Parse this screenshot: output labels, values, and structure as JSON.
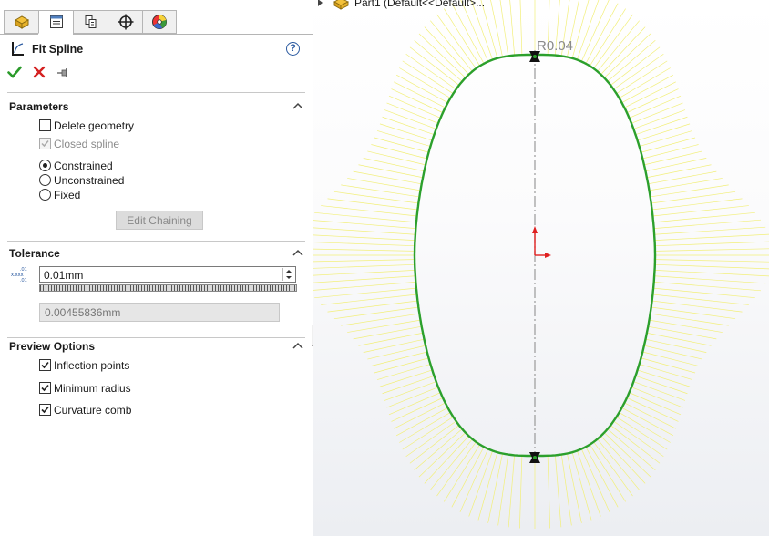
{
  "tabs": [
    {
      "name": "feature-manager",
      "icon": "feature-manager-icon"
    },
    {
      "name": "property-manager",
      "icon": "property-manager-icon"
    },
    {
      "name": "configuration-manager",
      "icon": "configuration-manager-icon"
    },
    {
      "name": "dim-xpert",
      "icon": "crosshair-icon"
    },
    {
      "name": "display-manager",
      "icon": "appearance-icon"
    }
  ],
  "panel": {
    "title": "Fit Spline",
    "help": "?"
  },
  "parameters": {
    "heading": "Parameters",
    "delete_geometry": {
      "label": "Delete geometry",
      "checked": false
    },
    "closed_spline": {
      "label": "Closed spline",
      "checked": true,
      "disabled": true
    },
    "constrained": {
      "label": "Constrained",
      "selected": true
    },
    "unconstrained": {
      "label": "Unconstrained",
      "selected": false
    },
    "fixed": {
      "label": "Fixed",
      "selected": false
    },
    "edit_chaining": "Edit Chaining"
  },
  "tolerance": {
    "heading": "Tolerance",
    "icon_text": "x.xxx",
    "value": "0.01mm",
    "computed": "0.00455836mm"
  },
  "preview": {
    "heading": "Preview Options",
    "inflection_points": {
      "label": "Inflection points",
      "checked": true
    },
    "minimum_radius": {
      "label": "Minimum radius",
      "checked": true
    },
    "curvature_comb": {
      "label": "Curvature comb",
      "checked": true
    }
  },
  "tree": {
    "label": "Part1  (Default<<Default>..."
  },
  "viewport": {
    "radius_label": "R0.04",
    "colors": {
      "spline": "#2ca02c",
      "comb": "#f2ef7a",
      "axis": "#9a9a9a",
      "origin": "#e02020"
    }
  }
}
